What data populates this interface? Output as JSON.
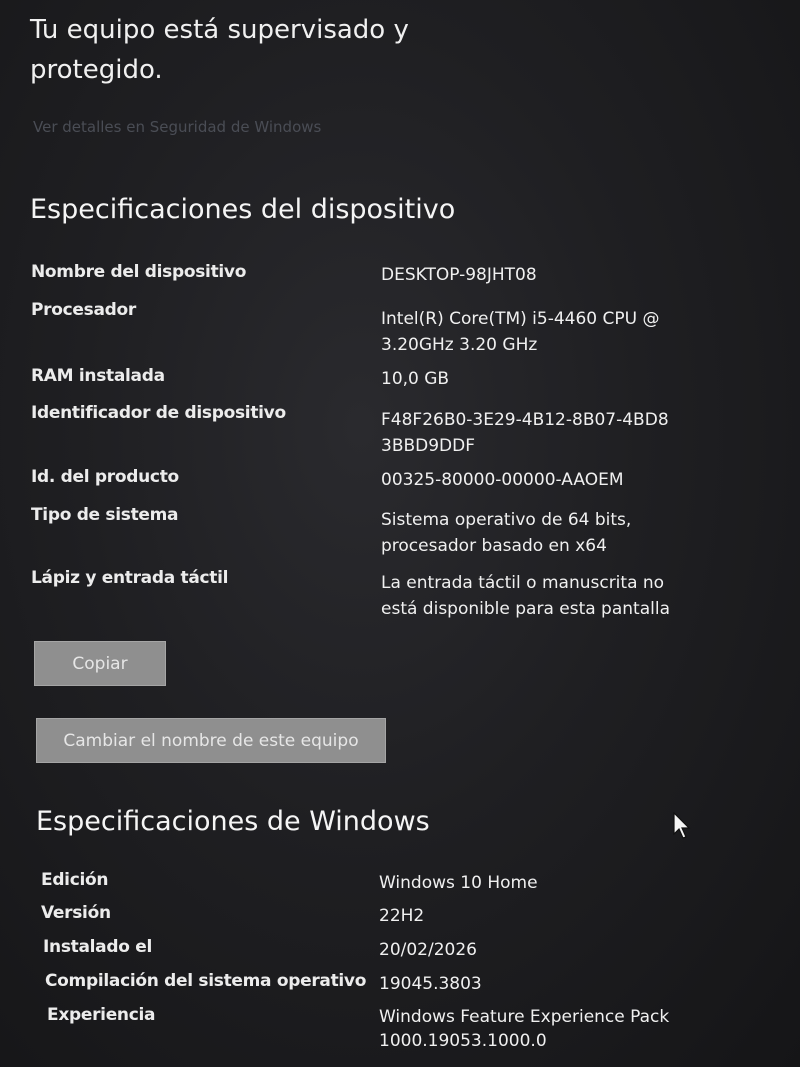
{
  "header": {
    "title": "Tu equipo está supervisado y protegido.",
    "security_link": "Ver detalles en Seguridad de Windows"
  },
  "device_specs": {
    "title": "Especificaciones del dispositivo",
    "rows": [
      {
        "label": "Nombre del dispositivo",
        "value": "DESKTOP-98JHT08"
      },
      {
        "label": "Procesador",
        "value": "Intel(R) Core(TM) i5-4460  CPU @\n3.20GHz   3.20 GHz"
      },
      {
        "label": "RAM instalada",
        "value": "10,0 GB"
      },
      {
        "label": "Identificador de dispositivo",
        "value": "F48F26B0-3E29-4B12-8B07-4BD8\n3BBD9DDF"
      },
      {
        "label": "Id. del producto",
        "value": "00325-80000-00000-AAOEM"
      },
      {
        "label": "Tipo de sistema",
        "value": "Sistema operativo de 64 bits,\nprocesador basado en x64"
      },
      {
        "label": "Lápiz y entrada táctil",
        "value": "La entrada táctil o manuscrita no\nestá disponible para esta pantalla"
      }
    ],
    "copy_button": "Copiar",
    "rename_button": "Cambiar el nombre de este equipo"
  },
  "windows_specs": {
    "title": "Especificaciones de Windows",
    "rows": [
      {
        "label": "Edición",
        "value": "Windows 10 Home"
      },
      {
        "label": "Versión",
        "value": "22H2"
      },
      {
        "label": "Instalado el",
        "value": "20/02/2026"
      },
      {
        "label": "Compilación del sistema operativo",
        "value": "19045.3803"
      },
      {
        "label": "Experiencia",
        "value": "Windows Feature Experience Pack\n1000.19053.1000.0"
      }
    ]
  },
  "icons": {
    "cursor": "mouse-pointer-icon"
  }
}
